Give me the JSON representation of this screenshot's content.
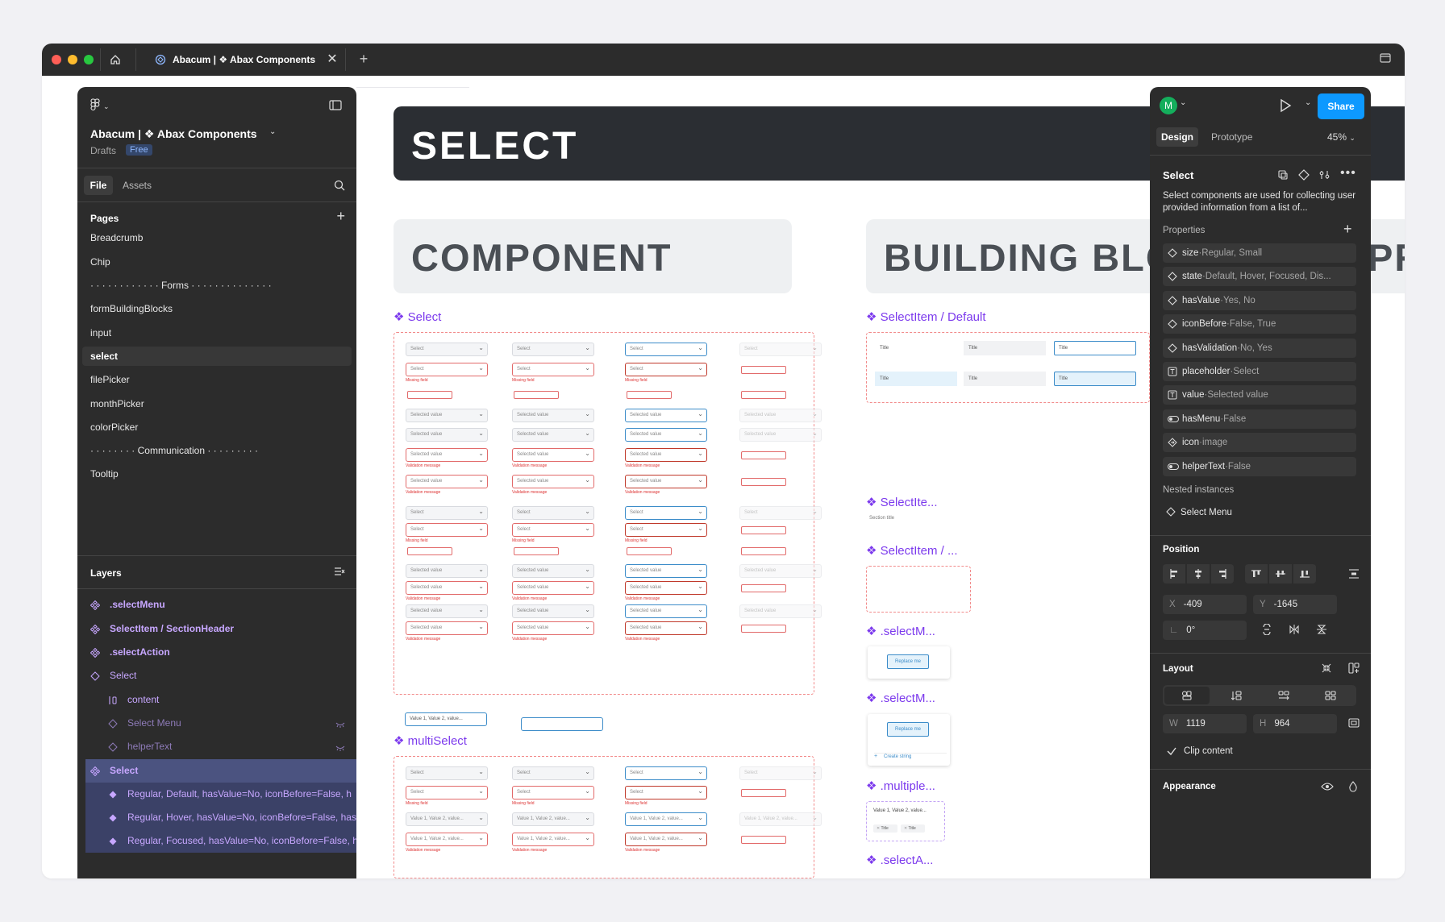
{
  "browser": {
    "tab_title": "Abacum | ❖ Abax Components"
  },
  "file": {
    "name": "Abacum | ❖ Abax Components",
    "location": "Drafts",
    "plan_badge": "Free",
    "tabs": [
      "File",
      "Assets"
    ]
  },
  "pages": {
    "heading": "Pages",
    "items": [
      "Breadcrumb",
      "Chip",
      "· · · · · · · · · · · · Forms · · · · · · · · · · · · · ·",
      "formBuildingBlocks",
      "input",
      "select",
      "filePicker",
      "monthPicker",
      "colorPicker",
      "· · · · · · · · Communication · · · · · · · · ·",
      "Tooltip"
    ]
  },
  "layers": {
    "heading": "Layers",
    "items": [
      {
        "label": ".selectMenu",
        "kind": "component"
      },
      {
        "label": "SelectItem / SectionHeader",
        "kind": "component"
      },
      {
        "label": ".selectAction",
        "kind": "component"
      },
      {
        "label": "Select",
        "kind": "instance"
      },
      {
        "label": "content",
        "kind": "frame"
      },
      {
        "label": "Select Menu",
        "kind": "hidden"
      },
      {
        "label": "helperText",
        "kind": "hidden"
      },
      {
        "label": "Select",
        "kind": "component-set"
      },
      {
        "label": "Regular, Default, hasValue=No, iconBefore=False, h",
        "kind": "variant"
      },
      {
        "label": "Regular, Hover, hasValue=No, iconBefore=False, has",
        "kind": "variant"
      },
      {
        "label": "Regular, Focused, hasValue=No, iconBefore=False, h",
        "kind": "variant"
      }
    ]
  },
  "canvas": {
    "hero_title": "SELECT",
    "section_component": "COMPONENT",
    "section_building": "BUILDING BLO",
    "section_cut": "PR",
    "comp_select": "❖ Select",
    "comp_multiselect": "❖ multiSelect",
    "bb_items": [
      "❖ SelectItem / Default",
      "❖ SelectIte...",
      "❖ SelectItem / ...",
      "❖ .selectM...",
      "❖ .selectM...",
      "❖ .multiple...",
      "❖ .selectA..."
    ],
    "section_title_small": "Section title",
    "replace_me": "Replace me",
    "create_string": "Create string",
    "title_word": "Title",
    "select_placeholder": "Select",
    "selected_value": "Selected value",
    "missing_field": "Missing field",
    "validation_message": "Validation message",
    "multi_value": "Value 1, Value 2, value...",
    "chip_title": "Title"
  },
  "design": {
    "avatar_letter": "M",
    "share_label": "Share",
    "tabs": [
      "Design",
      "Prototype"
    ],
    "zoom": "45%",
    "selection_name": "Select",
    "description": "Select components are used for collecting user provided information from a list of...",
    "properties_heading": "Properties",
    "properties": [
      {
        "name": "size",
        "value": "Regular, Small",
        "icon": "variant-icon"
      },
      {
        "name": "state",
        "value": "Default, Hover, Focused, Dis...",
        "icon": "variant-icon"
      },
      {
        "name": "hasValue",
        "value": "Yes, No",
        "icon": "variant-icon"
      },
      {
        "name": "iconBefore",
        "value": "False, True",
        "icon": "variant-icon"
      },
      {
        "name": "hasValidation",
        "value": "No, Yes",
        "icon": "variant-icon"
      },
      {
        "name": "placeholder",
        "value": "Select",
        "icon": "text-icon"
      },
      {
        "name": "value",
        "value": "Selected value",
        "icon": "text-icon"
      },
      {
        "name": "hasMenu",
        "value": "False",
        "icon": "toggle-icon"
      },
      {
        "name": "icon",
        "value": "image",
        "icon": "instance-swap-icon"
      },
      {
        "name": "helperText",
        "value": "False",
        "icon": "toggle-icon"
      }
    ],
    "nested_heading": "Nested instances",
    "nested_item": "Select Menu",
    "position_heading": "Position",
    "x_label": "X",
    "x_value": "-409",
    "y_label": "Y",
    "y_value": "-1645",
    "rotation": "0°",
    "layout_heading": "Layout",
    "w_label": "W",
    "w_value": "1119",
    "h_label": "H",
    "h_value": "964",
    "clip_content": "Clip content",
    "appearance_heading": "Appearance"
  }
}
